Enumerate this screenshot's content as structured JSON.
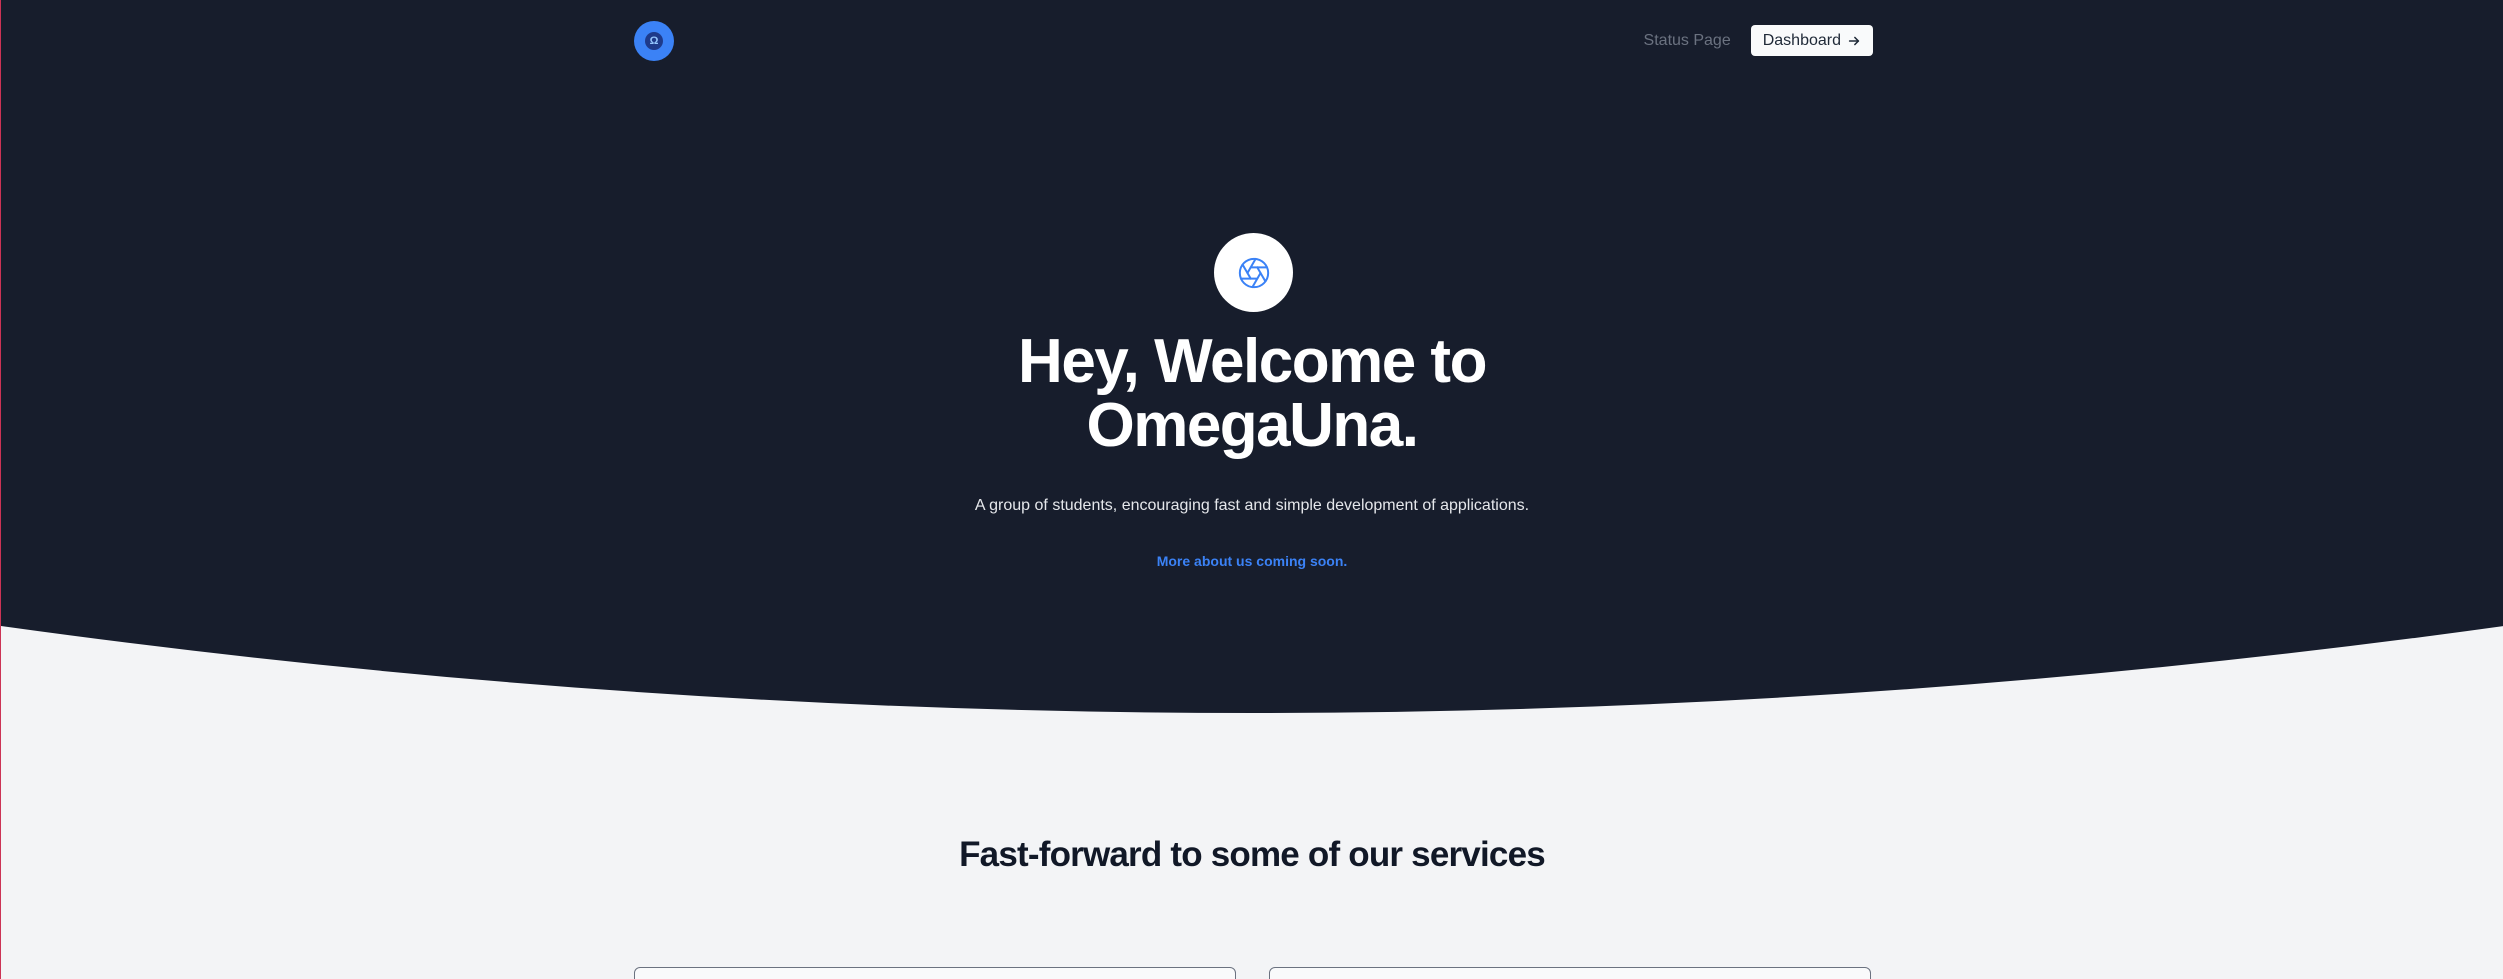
{
  "nav": {
    "logo_icon": "omegauna-logo-icon",
    "logo_glyph": "Ω",
    "status_link": "Status Page",
    "dashboard_button": "Dashboard",
    "dashboard_icon": "arrow-right-icon"
  },
  "hero": {
    "icon": "aperture-icon",
    "title_line1": "Hey, Welcome to",
    "title_line2": "OmegaUna.",
    "subtitle": "A group of students, encouraging fast and simple development of applications.",
    "link": "More about us coming soon."
  },
  "services": {
    "heading": "Fast-forward to some of our services"
  },
  "colors": {
    "hero_background": "#171d2c",
    "page_background": "#f3f4f6",
    "accent": "#3b82f6",
    "heading_text": "#111827"
  }
}
